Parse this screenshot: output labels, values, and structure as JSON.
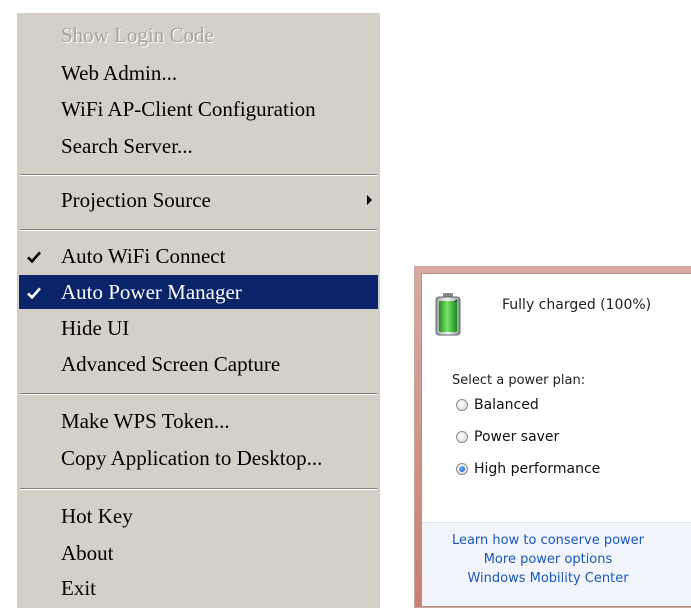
{
  "context_menu": {
    "items": [
      {
        "label": "Show Login Code",
        "disabled": true
      },
      {
        "label": "Web Admin..."
      },
      {
        "label": "WiFi AP-Client Configuration"
      },
      {
        "label": "Search Server..."
      },
      {
        "label": "Projection Source",
        "submenu": true
      },
      {
        "label": "Auto WiFi Connect",
        "checked": true
      },
      {
        "label": "Auto Power Manager",
        "checked": true,
        "highlighted": true
      },
      {
        "label": "Hide UI"
      },
      {
        "label": "Advanced Screen Capture"
      },
      {
        "label": "Make WPS Token..."
      },
      {
        "label": "Copy Application to Desktop..."
      },
      {
        "label": "Hot Key"
      },
      {
        "label": "About"
      },
      {
        "label": "Exit"
      }
    ]
  },
  "power_flyout": {
    "battery_status": "Fully charged (100%)",
    "battery_level": 1.0,
    "plan_heading": "Select a power plan:",
    "plans": [
      {
        "label": "Balanced",
        "selected": false
      },
      {
        "label": "Power saver",
        "selected": false
      },
      {
        "label": "High performance",
        "selected": true
      }
    ],
    "links": [
      "Learn how to conserve power",
      "More power options",
      "Windows Mobility Center"
    ]
  },
  "colors": {
    "menu_background": "#d4d0c8",
    "menu_highlight": "#0a246a",
    "link": "#1a57b8",
    "battery_fill": "#2fb52a"
  }
}
